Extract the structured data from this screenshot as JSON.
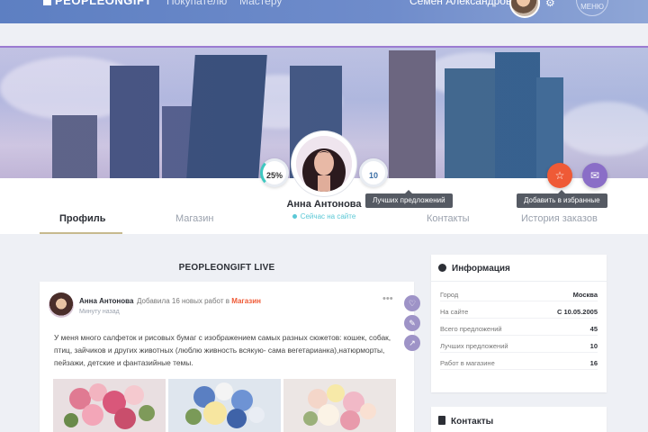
{
  "header": {
    "logo": "PEOPLEONGIFT",
    "nav": [
      "Покупателю",
      "Мастеру"
    ],
    "user_name": "Семён Александрович",
    "menu_label": "МЕНЮ"
  },
  "profile": {
    "name": "Анна Антонова",
    "status": "Сейчас на сайте",
    "progress_label": "25%",
    "progress_value": 0.25,
    "best_offers_count": "10",
    "best_offers_tooltip": "Лучших предложений",
    "favorite_tooltip": "Добавить в избранные"
  },
  "tabs": [
    "Профиль",
    "Магазин",
    "Контакты",
    "История заказов"
  ],
  "feed": {
    "title": "PEOPLEONGIFT LIVE",
    "post": {
      "author": "Анна Антонова",
      "action": "Добавила 16 новых работ в ",
      "shop_link": "Магазин",
      "time": "Минуту назад",
      "text": "У меня много салфеток и рисовых бумаг с изображением самых разных сюжетов: кошек, собак, птиц, зайчиков и других животных (люблю живность всякую- сама вегетарианка),натюрморты, пейзажи, детские и фантазийные темы."
    }
  },
  "info": {
    "title": "Информация",
    "rows": [
      {
        "label": "Город",
        "value": "Москва"
      },
      {
        "label": "На сайте",
        "value": "С 10.05.2005"
      },
      {
        "label": "Всего предложений",
        "value": "45"
      },
      {
        "label": "Лучших предложений",
        "value": "10"
      },
      {
        "label": "Работ в магазине",
        "value": "16"
      }
    ]
  },
  "contacts": {
    "title": "Контакты"
  },
  "colors": {
    "accent": "#ef5a36",
    "purple": "#8a6ec7",
    "online": "#5bc8d6",
    "nav": "#6f8ccb"
  }
}
